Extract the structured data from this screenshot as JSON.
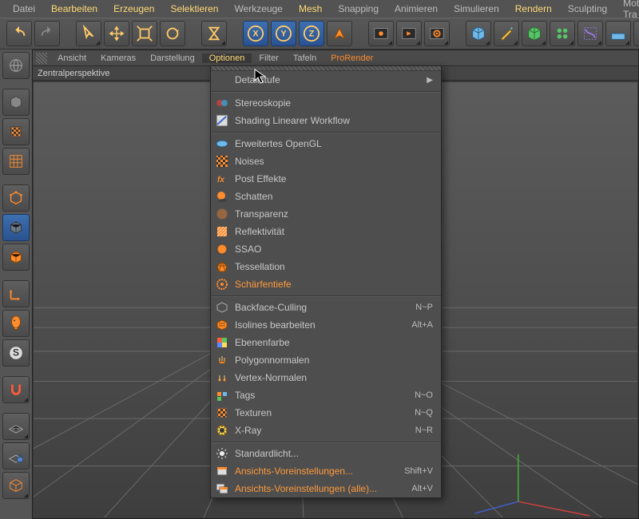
{
  "main_menu": {
    "items": [
      {
        "label": "Datei",
        "dim": true
      },
      {
        "label": "Bearbeiten",
        "dim": false
      },
      {
        "label": "Erzeugen",
        "dim": false
      },
      {
        "label": "Selektieren",
        "dim": false
      },
      {
        "label": "Werkzeuge",
        "dim": true
      },
      {
        "label": "Mesh",
        "dim": false
      },
      {
        "label": "Snapping",
        "dim": true
      },
      {
        "label": "Animieren",
        "dim": true
      },
      {
        "label": "Simulieren",
        "dim": true
      },
      {
        "label": "Rendern",
        "dim": false
      },
      {
        "label": "Sculpting",
        "dim": true
      },
      {
        "label": "Motion Tra",
        "dim": true
      }
    ]
  },
  "viewport": {
    "menu": [
      "Ansicht",
      "Kameras",
      "Darstellung",
      "Optionen",
      "Filter",
      "Tafeln",
      "ProRender"
    ],
    "active_index": 3,
    "title": "Zentralperspektive"
  },
  "dropdown": {
    "groups": [
      [
        {
          "label": "Detailstufe",
          "icon": "blank",
          "arrow": true
        }
      ],
      [
        {
          "label": "Stereoskopie",
          "icon": "stereo"
        },
        {
          "label": "Shading Linearer Workflow",
          "icon": "linear"
        }
      ],
      [
        {
          "label": "Erweitertes OpenGL",
          "icon": "ogl"
        },
        {
          "label": "Noises",
          "icon": "noise"
        },
        {
          "label": "Post Effekte",
          "icon": "fx"
        },
        {
          "label": "Schatten",
          "icon": "shadow"
        },
        {
          "label": "Transparenz",
          "icon": "transp"
        },
        {
          "label": "Reflektivität",
          "icon": "reflect"
        },
        {
          "label": "SSAO",
          "icon": "ssao"
        },
        {
          "label": "Tessellation",
          "icon": "tess"
        },
        {
          "label": "Schärfentiefe",
          "icon": "dof",
          "orange": true
        }
      ],
      [
        {
          "label": "Backface-Culling",
          "icon": "bcull",
          "shortcut": "N~P"
        },
        {
          "label": "Isolines bearbeiten",
          "icon": "iso",
          "shortcut": "Alt+A"
        },
        {
          "label": "Ebenenfarbe",
          "icon": "layer"
        },
        {
          "label": "Polygonnormalen",
          "icon": "pnorm"
        },
        {
          "label": "Vertex-Normalen",
          "icon": "vnorm"
        },
        {
          "label": "Tags",
          "icon": "tags",
          "shortcut": "N~O"
        },
        {
          "label": "Texturen",
          "icon": "tex",
          "shortcut": "N~Q"
        },
        {
          "label": "X-Ray",
          "icon": "xray",
          "shortcut": "N~R"
        }
      ],
      [
        {
          "label": "Standardlicht...",
          "icon": "light"
        },
        {
          "label": "Ansichts-Voreinstellungen...",
          "icon": "pref",
          "shortcut": "Shift+V",
          "orange": true
        },
        {
          "label": "Ansichts-Voreinstellungen (alle)...",
          "icon": "prefall",
          "shortcut": "Alt+V",
          "orange": true
        }
      ]
    ]
  },
  "axis_letters": {
    "x": "X",
    "y": "Y",
    "z": "Z"
  }
}
